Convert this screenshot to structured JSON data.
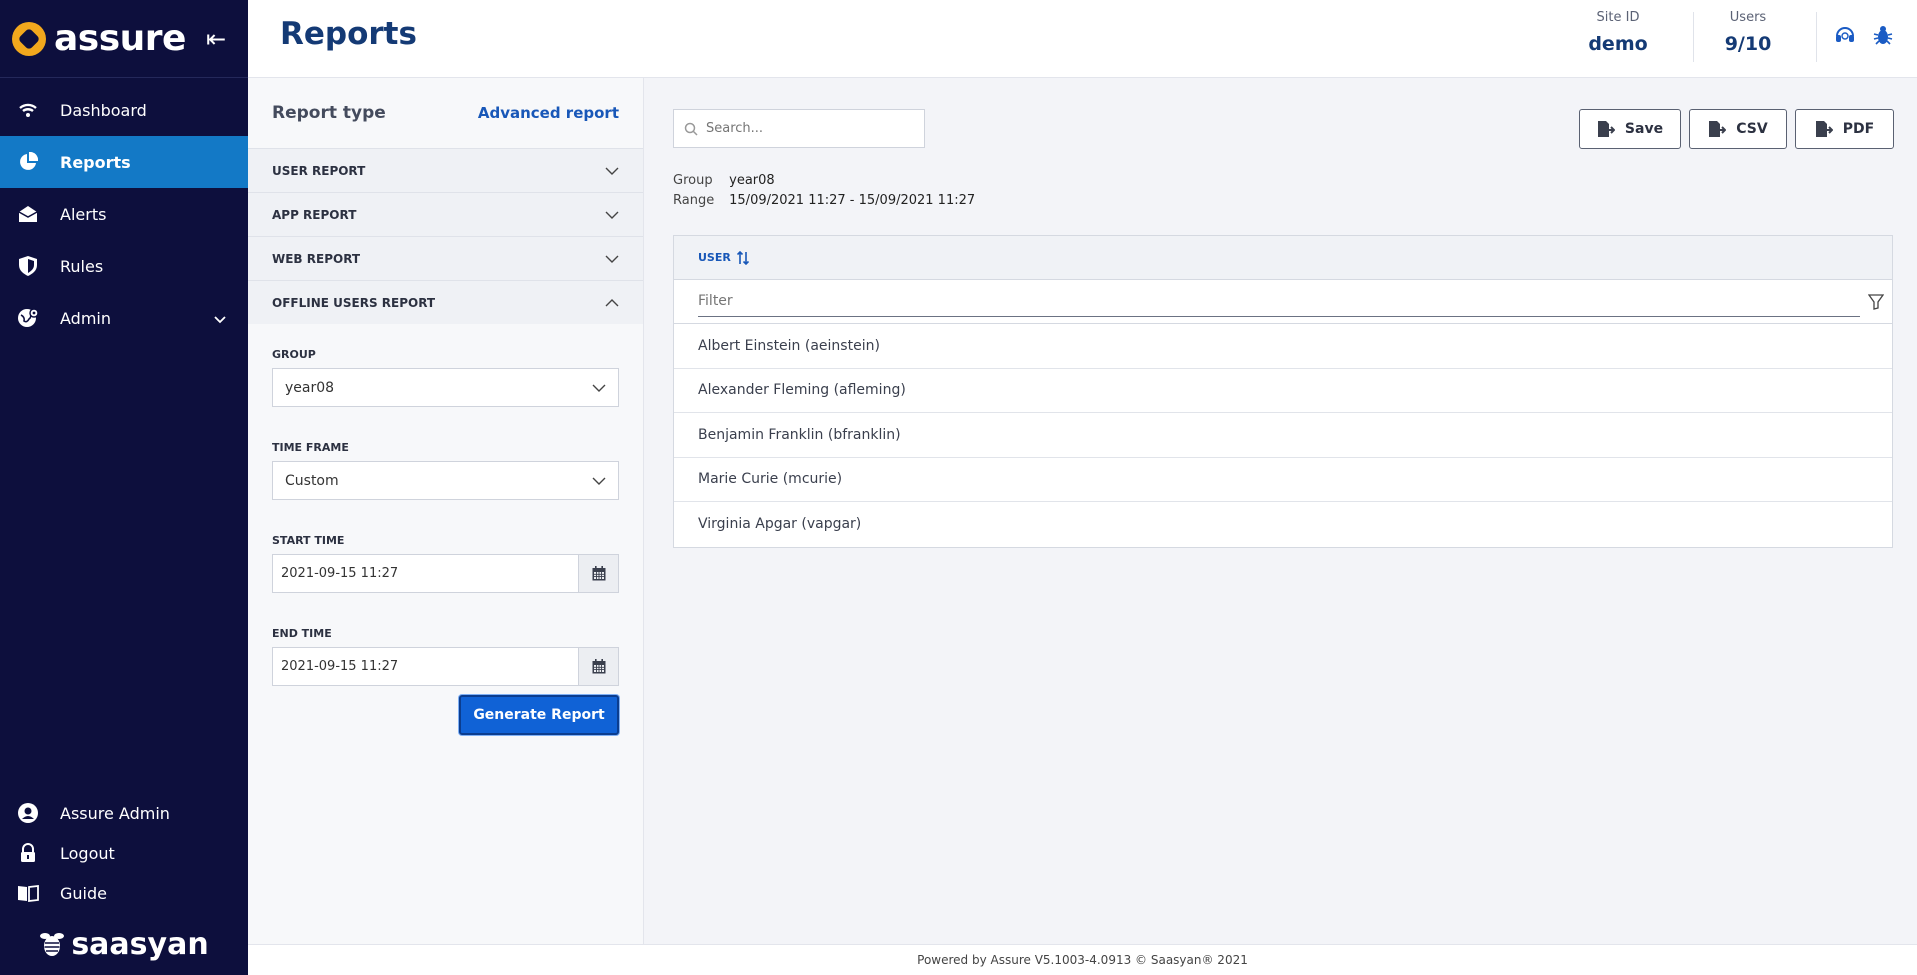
{
  "brand": {
    "name": "assure"
  },
  "header": {
    "title": "Reports",
    "site_id_label": "Site ID",
    "site_id_value": "demo",
    "users_label": "Users",
    "users_value": "9/10"
  },
  "sidebar": {
    "items": [
      {
        "label": "Dashboard",
        "icon": "wifi-icon"
      },
      {
        "label": "Reports",
        "icon": "pie-chart-icon"
      },
      {
        "label": "Alerts",
        "icon": "envelope-icon"
      },
      {
        "label": "Rules",
        "icon": "shield-icon"
      },
      {
        "label": "Admin",
        "icon": "globe-gear-icon"
      }
    ],
    "bottom": [
      {
        "label": "Assure Admin",
        "icon": "user-icon"
      },
      {
        "label": "Logout",
        "icon": "lock-icon"
      },
      {
        "label": "Guide",
        "icon": "book-icon"
      }
    ],
    "footer_brand": "saasyan"
  },
  "panel": {
    "title": "Report type",
    "advanced_link": "Advanced report",
    "accordion": [
      "USER REPORT",
      "APP REPORT",
      "WEB REPORT",
      "OFFLINE USERS REPORT"
    ],
    "group_label": "GROUP",
    "group_value": "year08",
    "timeframe_label": "TIME FRAME",
    "timeframe_value": "Custom",
    "start_label": "START TIME",
    "start_value": "2021-09-15 11:27",
    "end_label": "END TIME",
    "end_value": "2021-09-15 11:27",
    "generate_label": "Generate Report"
  },
  "main": {
    "search_placeholder": "Search...",
    "buttons": {
      "save": "Save",
      "csv": "CSV",
      "pdf": "PDF"
    },
    "group_key": "Group",
    "group_value": "year08",
    "range_key": "Range",
    "range_value": "15/09/2021 11:27 - 15/09/2021 11:27",
    "table_header": "USER",
    "filter_placeholder": "Filter",
    "rows": [
      "Albert Einstein (aeinstein)",
      "Alexander Fleming (afleming)",
      "Benjamin Franklin (bfranklin)",
      "Marie Curie (mcurie)",
      "Virginia Apgar (vapgar)"
    ]
  },
  "footer": {
    "text": "Powered by Assure V5.1003-4.0913 © Saasyan® 2021"
  },
  "colors": {
    "sidebar_bg": "#0d0f3d",
    "active_nav": "#1379c6",
    "accent": "#1062d6",
    "title": "#143a75",
    "logo": "#f2a81d"
  }
}
